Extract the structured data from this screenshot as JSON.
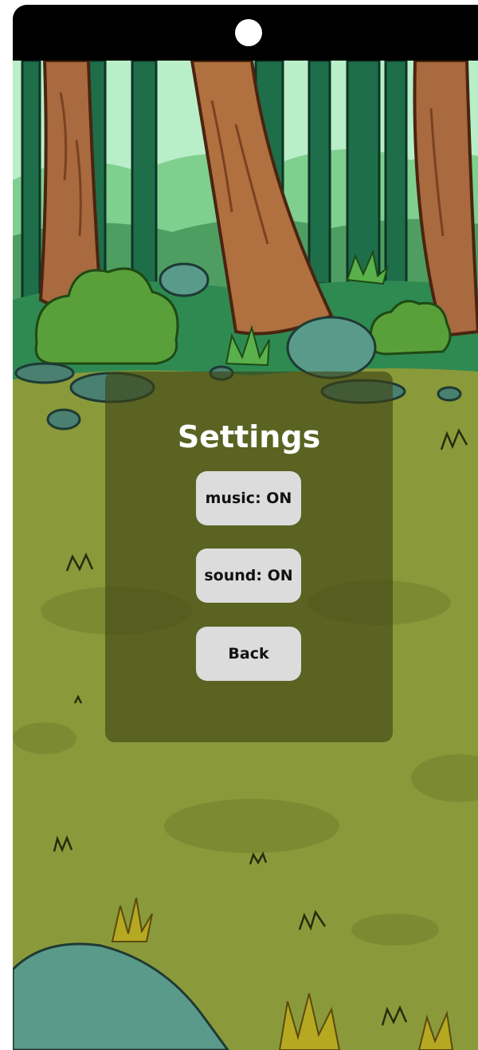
{
  "settings": {
    "title": "Settings",
    "buttons": {
      "music": "music: ON",
      "sound": "sound: ON",
      "back": "Back"
    }
  },
  "colors": {
    "ground": "#8a9a3a",
    "panel": "#3e4214",
    "button": "#dcdcdc",
    "status_bar": "#000000"
  }
}
